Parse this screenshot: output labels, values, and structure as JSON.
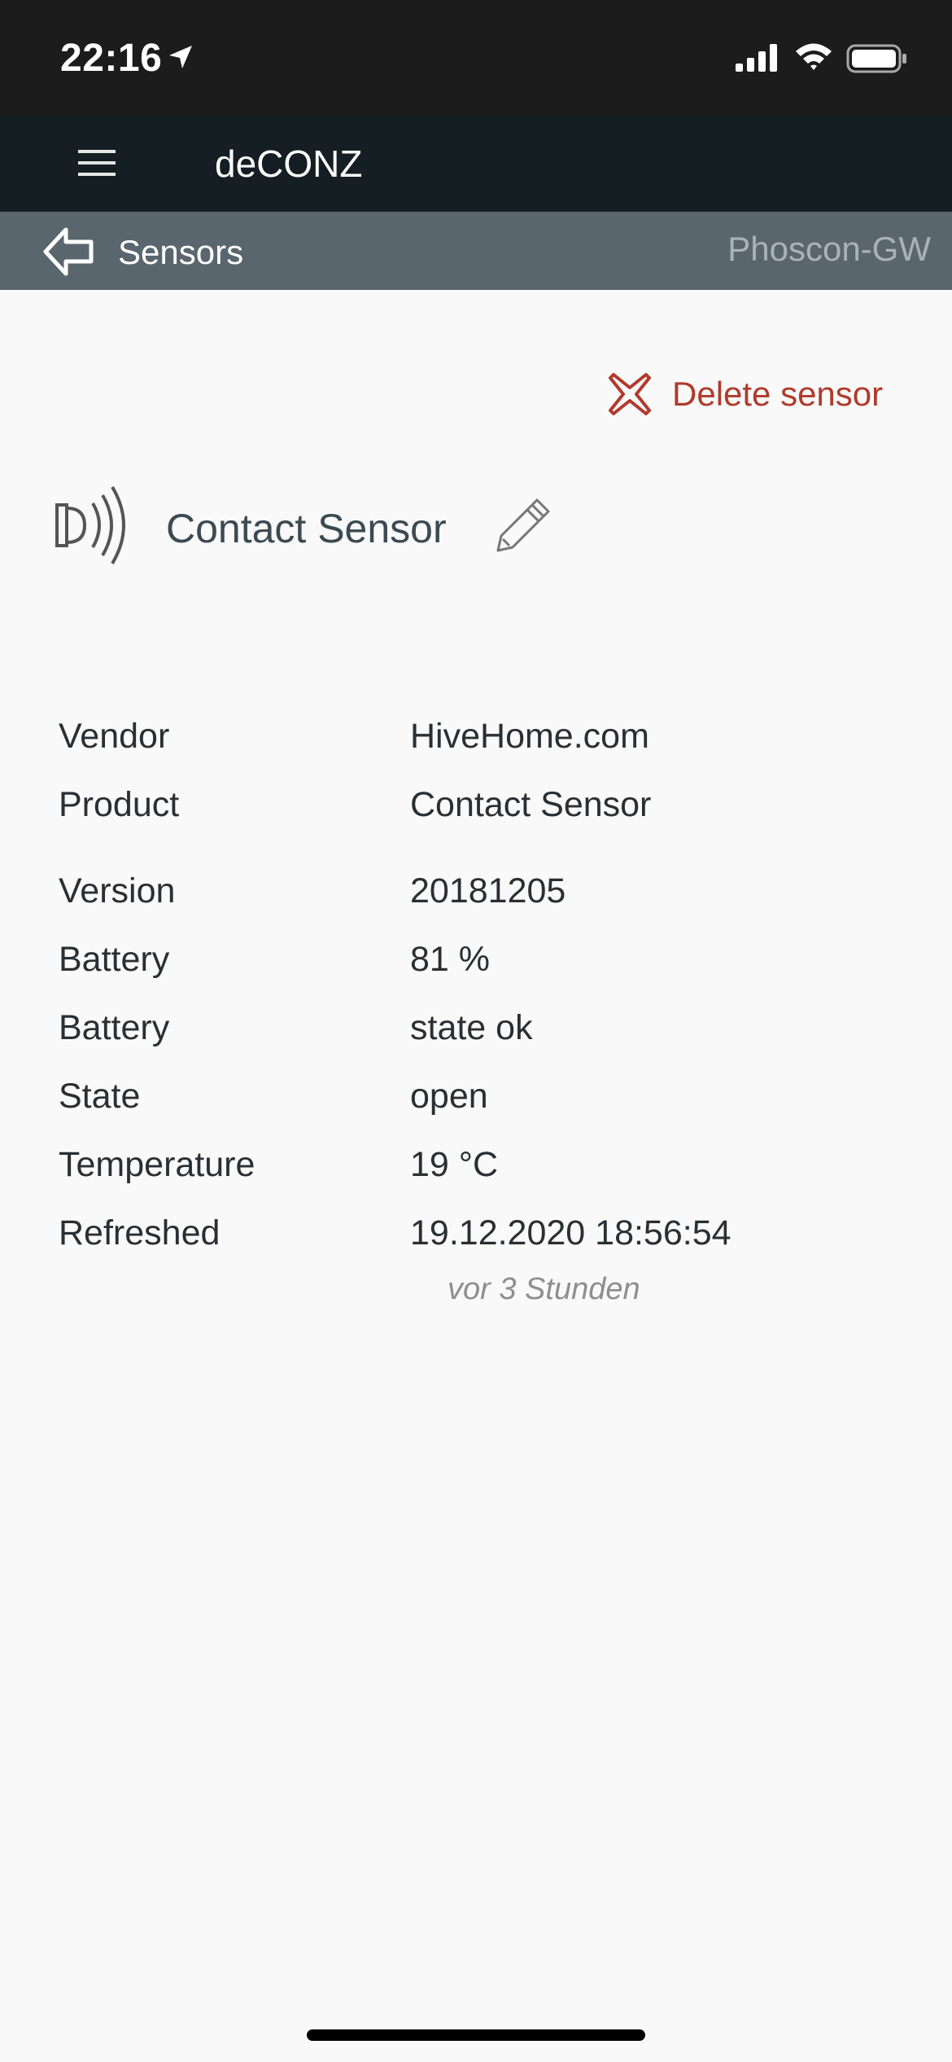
{
  "status_bar": {
    "time": "22:16"
  },
  "header": {
    "title": "deCONZ"
  },
  "subheader": {
    "back_label": "Sensors",
    "gateway": "Phoscon-GW"
  },
  "actions": {
    "delete_label": "Delete sensor"
  },
  "sensor": {
    "name": "Contact Sensor"
  },
  "details": [
    {
      "label": "Vendor",
      "value": "HiveHome.com"
    },
    {
      "label": "Product",
      "value": "Contact Sensor"
    },
    {
      "label": "Version",
      "value": "20181205"
    },
    {
      "label": "Battery",
      "value": "81 %"
    },
    {
      "label": "Battery",
      "value": "state ok"
    },
    {
      "label": "State",
      "value": "open"
    },
    {
      "label": "Temperature",
      "value": "19 °C"
    },
    {
      "label": "Refreshed",
      "value": "19.12.2020 18:56:54"
    }
  ],
  "refreshed_relative": "vor 3 Stunden",
  "icons": {
    "location": "location-arrow-icon",
    "signal": "cellular-signal-icon",
    "wifi": "wifi-icon",
    "battery": "battery-icon",
    "menu": "hamburger-menu-icon",
    "back": "back-arrow-icon",
    "delete": "close-x-icon",
    "sensor": "contact-sensor-icon",
    "edit": "pencil-icon"
  },
  "colors": {
    "status_bar": "#1c1c1c",
    "header": "#151e23",
    "subheader": "#5a666e",
    "delete": "#b13a2c",
    "background": "#f9f9f9"
  }
}
